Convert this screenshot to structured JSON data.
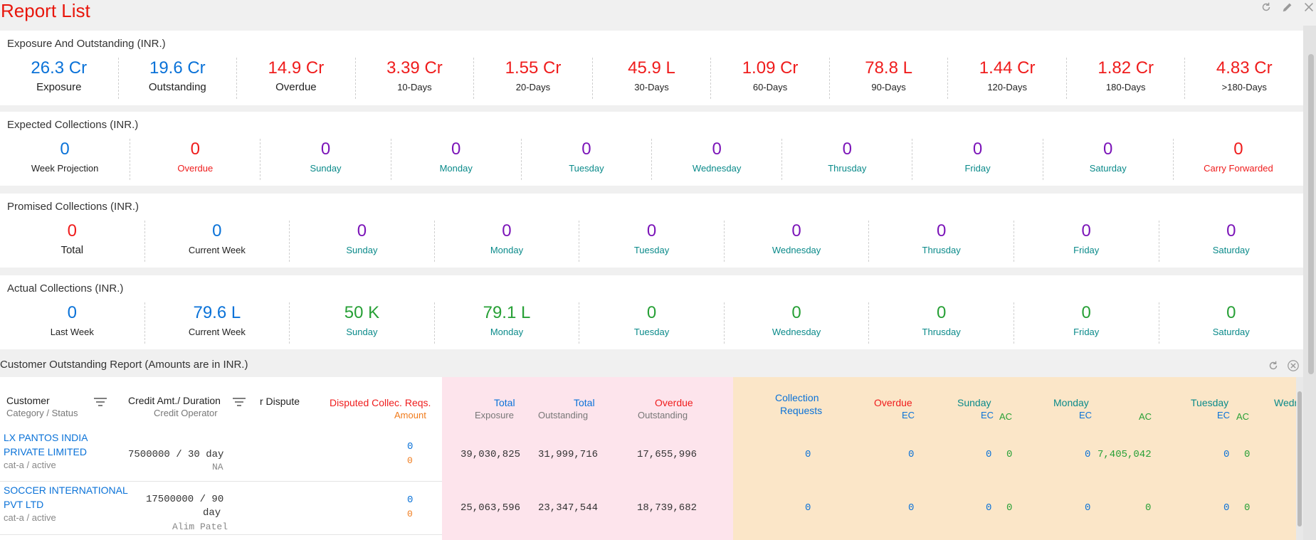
{
  "page": {
    "title": "Report List"
  },
  "exposure": {
    "title": "Exposure And Outstanding (INR.)",
    "items": [
      {
        "value": "26.3 Cr",
        "label": "Exposure"
      },
      {
        "value": "19.6 Cr",
        "label": "Outstanding"
      },
      {
        "value": "14.9 Cr",
        "label": "Overdue"
      },
      {
        "value": "3.39 Cr",
        "label": "10-Days"
      },
      {
        "value": "1.55 Cr",
        "label": "20-Days"
      },
      {
        "value": "45.9 L",
        "label": "30-Days"
      },
      {
        "value": "1.09 Cr",
        "label": "60-Days"
      },
      {
        "value": "78.8 L",
        "label": "90-Days"
      },
      {
        "value": "1.44 Cr",
        "label": "120-Days"
      },
      {
        "value": "1.82 Cr",
        "label": "180-Days"
      },
      {
        "value": "4.83 Cr",
        "label": ">180-Days"
      }
    ]
  },
  "expected": {
    "title": "Expected Collections (INR.)",
    "items": [
      {
        "value": "0",
        "label": "Week Projection"
      },
      {
        "value": "0",
        "label": "Overdue"
      },
      {
        "value": "0",
        "label": "Sunday"
      },
      {
        "value": "0",
        "label": "Monday"
      },
      {
        "value": "0",
        "label": "Tuesday"
      },
      {
        "value": "0",
        "label": "Wednesday"
      },
      {
        "value": "0",
        "label": "Thrusday"
      },
      {
        "value": "0",
        "label": "Friday"
      },
      {
        "value": "0",
        "label": "Saturday"
      },
      {
        "value": "0",
        "label": "Carry Forwarded"
      }
    ]
  },
  "promised": {
    "title": "Promised Collections (INR.)",
    "items": [
      {
        "value": "0",
        "label": "Total"
      },
      {
        "value": "0",
        "label": "Current Week"
      },
      {
        "value": "0",
        "label": "Sunday"
      },
      {
        "value": "0",
        "label": "Monday"
      },
      {
        "value": "0",
        "label": "Tuesday"
      },
      {
        "value": "0",
        "label": "Wednesday"
      },
      {
        "value": "0",
        "label": "Thrusday"
      },
      {
        "value": "0",
        "label": "Friday"
      },
      {
        "value": "0",
        "label": "Saturday"
      }
    ]
  },
  "actual": {
    "title": "Actual Collections (INR.)",
    "items": [
      {
        "value": "0",
        "label": "Last Week"
      },
      {
        "value": "79.6 L",
        "label": "Current Week"
      },
      {
        "value": "50 K",
        "label": "Sunday"
      },
      {
        "value": "79.1 L",
        "label": "Monday"
      },
      {
        "value": "0",
        "label": "Tuesday"
      },
      {
        "value": "0",
        "label": "Wednesday"
      },
      {
        "value": "0",
        "label": "Thrusday"
      },
      {
        "value": "0",
        "label": "Friday"
      },
      {
        "value": "0",
        "label": "Saturday"
      }
    ]
  },
  "report": {
    "title": "Customer Outstanding Report (Amounts are in INR.)",
    "headers": {
      "customer": "Customer",
      "customer_sub": "Category / Status",
      "credit": "Credit Amt./ Duration",
      "credit_sub": "Credit Operator",
      "dispute": "r Dispute",
      "disputed": "Disputed Collec. Reqs.",
      "disputed_sub": "Amount",
      "total_exp": "Total",
      "total_exp_sub": "Exposure",
      "total_out": "Total",
      "total_out_sub": "Outstanding",
      "overdue": "Overdue",
      "overdue_sub": "Outstanding",
      "collreq_1": "Collection",
      "collreq_2": "Requests",
      "overdue2": "Overdue",
      "ec": "EC",
      "ac": "AC",
      "sunday": "Sunday",
      "monday": "Monday",
      "tuesday": "Tuesday",
      "wed": "Wedr"
    },
    "rows": [
      {
        "name_1": "LX PANTOS INDIA",
        "name_2": "PRIVATE LIMITED",
        "category": "cat-a / active",
        "credit_1": "7500000 / 30 day",
        "credit_2": "",
        "operator": "NA",
        "disputed_count": "0",
        "disputed_amount": "0",
        "total_exposure": "39,030,825",
        "total_outstanding": "31,999,716",
        "overdue_outstanding": "17,655,996",
        "collection_requests": "0",
        "overdue_ec": "0",
        "sunday_ec": "0",
        "sunday_ac": "0",
        "monday_ec": "0",
        "monday_ac": "7,405,042",
        "tuesday_ec": "0",
        "tuesday_ac": "0"
      },
      {
        "name_1": "SOCCER INTERNATIONAL",
        "name_2": "PVT LTD",
        "category": "cat-a / active",
        "credit_1": "17500000 / 90",
        "credit_2": "day",
        "operator": "Alim Patel",
        "disputed_count": "0",
        "disputed_amount": "0",
        "total_exposure": "25,063,596",
        "total_outstanding": "23,347,544",
        "overdue_outstanding": "18,739,682",
        "collection_requests": "0",
        "overdue_ec": "0",
        "sunday_ec": "0",
        "sunday_ac": "0",
        "monday_ec": "0",
        "monday_ac": "0",
        "tuesday_ec": "0",
        "tuesday_ac": "0"
      }
    ]
  },
  "colors": {
    "title_red": "#e8160c",
    "blue": "#0a72d8",
    "red": "#ef1c1c",
    "purple": "#7b14b8",
    "teal": "#0a8a8a",
    "green": "#27a036",
    "pink_bg": "#fde4ec",
    "tan_bg": "#fbe6c8"
  },
  "icons": [
    "refresh-icon",
    "edit-icon",
    "close-icon",
    "filter-icon"
  ]
}
